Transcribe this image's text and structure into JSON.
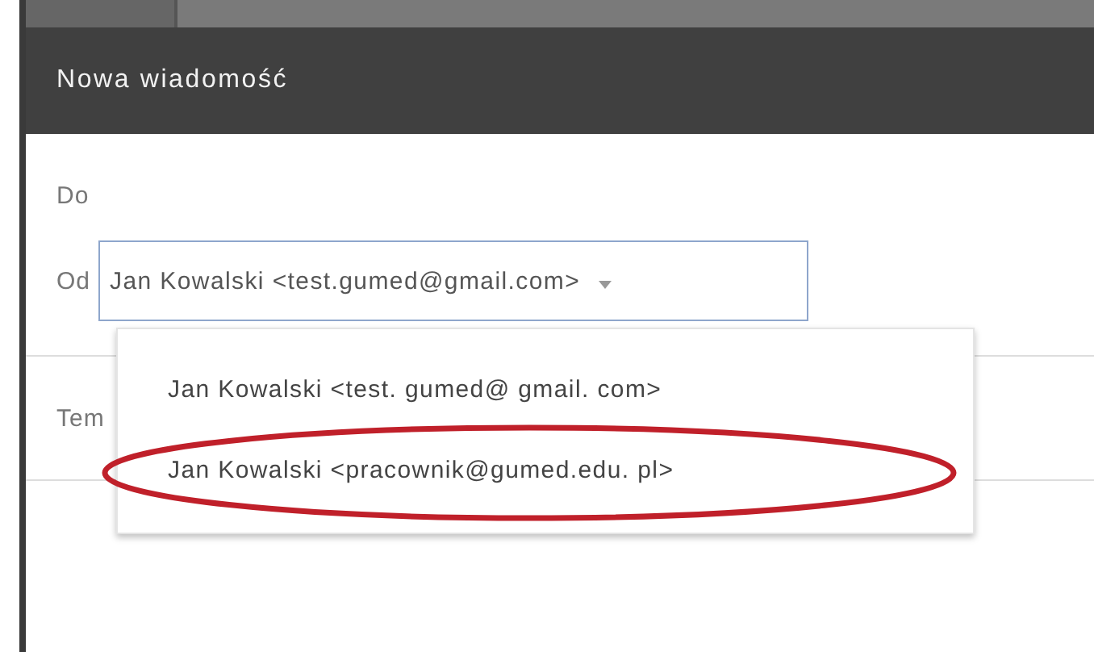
{
  "window": {
    "title": "Nowa wiadomość"
  },
  "fields": {
    "to_label": "Do",
    "from_label": "Od",
    "from_value": "Jan Kowalski <test.gumed@gmail.com>",
    "subject_label": "Tem"
  },
  "from_menu": {
    "items": [
      {
        "label": "Jan Kowalski <test. gumed@ gmail. com>",
        "annotated": false
      },
      {
        "label": "Jan Kowalski <pracownik@gumed.edu. pl>",
        "annotated": true
      }
    ]
  }
}
